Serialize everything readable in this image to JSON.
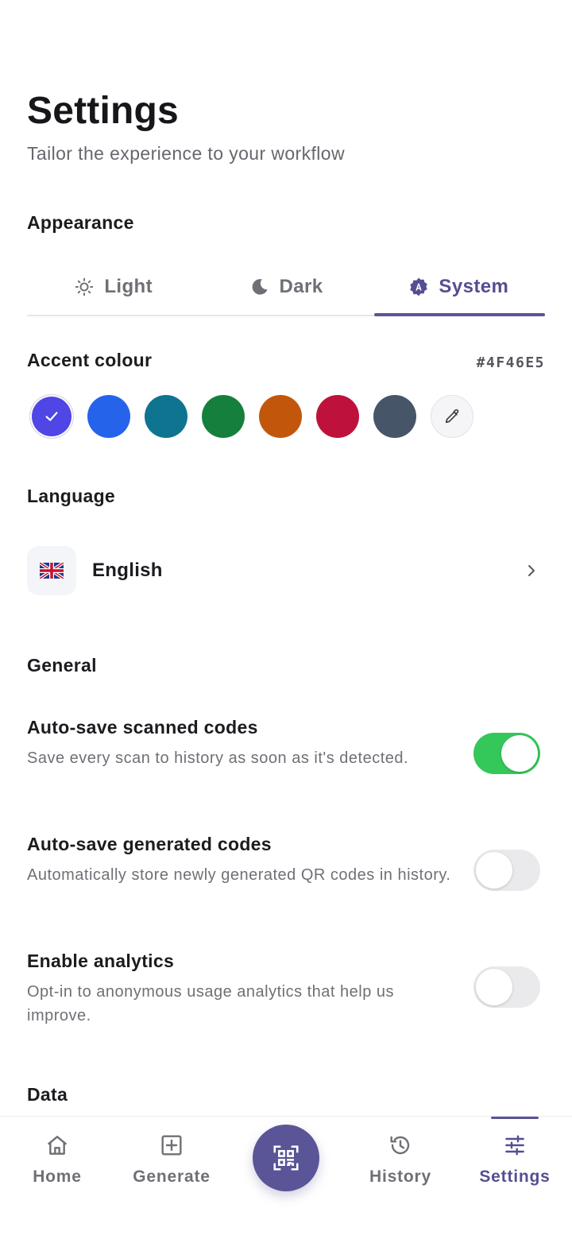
{
  "header": {
    "title": "Settings",
    "subtitle": "Tailor the experience to your workflow"
  },
  "appearance": {
    "heading": "Appearance",
    "options": [
      {
        "label": "Light",
        "icon": "sun-icon",
        "active": false
      },
      {
        "label": "Dark",
        "icon": "moon-icon",
        "active": false
      },
      {
        "label": "System",
        "icon": "auto-icon",
        "active": true
      }
    ]
  },
  "accent": {
    "heading": "Accent colour",
    "hex": "#4F46E5",
    "swatches": [
      "#4F46E5",
      "#2563EB",
      "#0E7490",
      "#15803D",
      "#C2570C",
      "#BE123C",
      "#475569"
    ],
    "selected_index": 0
  },
  "language": {
    "heading": "Language",
    "value": "English",
    "flag": "🇬🇧"
  },
  "general": {
    "heading": "General",
    "items": [
      {
        "title": "Auto-save scanned codes",
        "description": "Save every scan to history as soon as it's detected.",
        "enabled": true
      },
      {
        "title": "Auto-save generated codes",
        "description": "Automatically store newly generated QR codes in history.",
        "enabled": false
      },
      {
        "title": "Enable analytics",
        "description": "Opt-in to anonymous usage analytics that help us improve.",
        "enabled": false
      }
    ]
  },
  "data": {
    "heading": "Data"
  },
  "nav": {
    "items": [
      {
        "label": "Home",
        "icon": "home-icon"
      },
      {
        "label": "Generate",
        "icon": "plus-square-icon"
      },
      {
        "label": "History",
        "icon": "history-icon"
      },
      {
        "label": "Settings",
        "icon": "sliders-icon"
      }
    ],
    "active": "Settings",
    "fab_icon": "qr-scan-icon"
  },
  "colors": {
    "brand": "#5A5596",
    "toggle_on": "#34C759"
  }
}
